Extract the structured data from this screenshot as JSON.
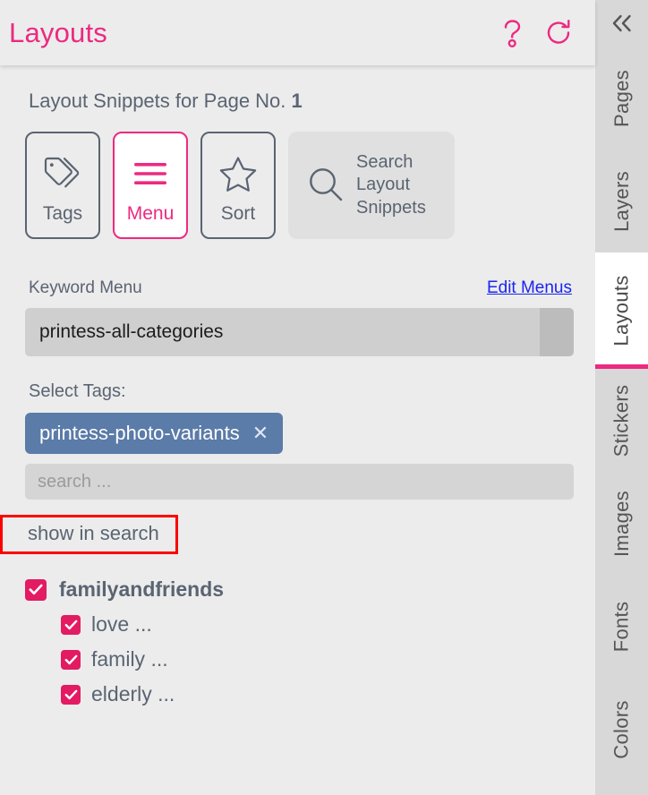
{
  "header": {
    "title": "Layouts",
    "help_icon": "question-mark-icon",
    "redo_icon": "redo-icon"
  },
  "main": {
    "section_title_prefix": "Layout Snippets for Page No. ",
    "page_number": "1",
    "toolbar": [
      {
        "label": "Tags",
        "icon": "tag-icon",
        "active": false
      },
      {
        "label": "Menu",
        "icon": "hamburger-icon",
        "active": true
      },
      {
        "label": "Sort",
        "icon": "star-icon",
        "active": false
      }
    ],
    "search_button": {
      "label": "Search\nLayout\nSnippets",
      "line1": "Search",
      "line2": "Layout",
      "line3": "Snippets",
      "icon": "search-icon"
    },
    "keyword_menu": {
      "label": "Keyword Menu",
      "edit_link": "Edit Menus",
      "selected_value": "printess-all-categories"
    },
    "select_tags": {
      "label": "Select Tags:",
      "chips": [
        {
          "label": "printess-photo-variants",
          "remove_icon": "close-icon"
        }
      ],
      "search_placeholder": "search ...",
      "search_value": ""
    },
    "show_in_search": {
      "label": "show in search",
      "annotation_color": "#fc0000"
    },
    "tag_tree": [
      {
        "label": "familyandfriends",
        "checked": true,
        "level": 0
      },
      {
        "label": "love ...",
        "checked": true,
        "level": 1
      },
      {
        "label": "family ...",
        "checked": true,
        "level": 1
      },
      {
        "label": "elderly ...",
        "checked": true,
        "level": 1
      }
    ]
  },
  "sidebar": {
    "collapse_icon": "chevron-double-left-icon",
    "tabs": [
      {
        "label": "Pages",
        "active": false
      },
      {
        "label": "Layers",
        "active": false
      },
      {
        "label": "Layouts",
        "active": true
      },
      {
        "label": "Stickers",
        "active": false
      },
      {
        "label": "Images",
        "active": false
      },
      {
        "label": "Fonts",
        "active": false
      },
      {
        "label": "Colors",
        "active": false
      }
    ]
  },
  "colors": {
    "accent_pink": "#ec2a80",
    "checkbox_pink": "#e31b63",
    "chip_blue": "#5b7ba8",
    "link_blue": "#1b25ef",
    "text_slate": "#5a6472",
    "panel_bg": "#ececec",
    "sidebar_bg": "#d8d8d8",
    "annotation_red": "#fc0000"
  }
}
